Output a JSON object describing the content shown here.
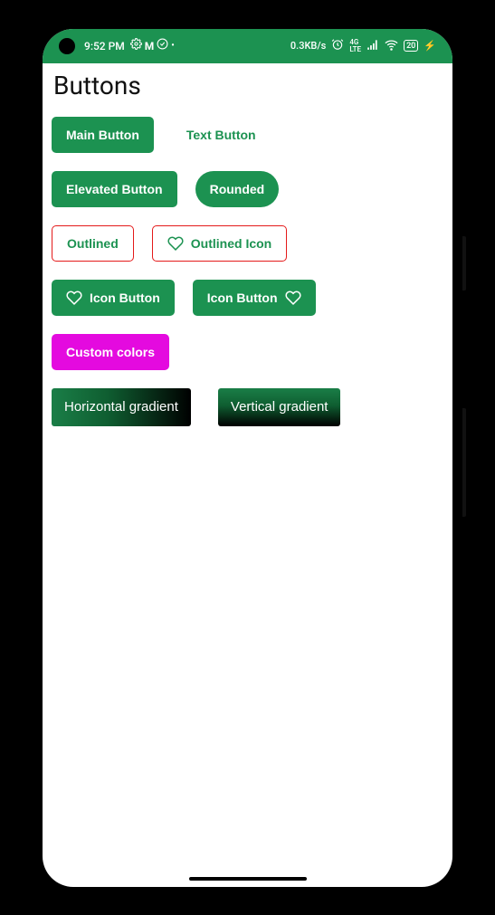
{
  "status_bar": {
    "time": "9:52 PM",
    "data_rate": "0.3KB/s",
    "battery": "20"
  },
  "page": {
    "title": "Buttons"
  },
  "buttons": {
    "main": "Main Button",
    "text": "Text Button",
    "elevated": "Elevated Button",
    "rounded": "Rounded",
    "outlined": "Outlined",
    "outlined_icon": "Outlined Icon",
    "icon_left": "Icon Button",
    "icon_right": "Icon Button",
    "custom": "Custom colors",
    "hgrad": "Horizontal gradient",
    "vgrad": "Vertical gradient"
  }
}
